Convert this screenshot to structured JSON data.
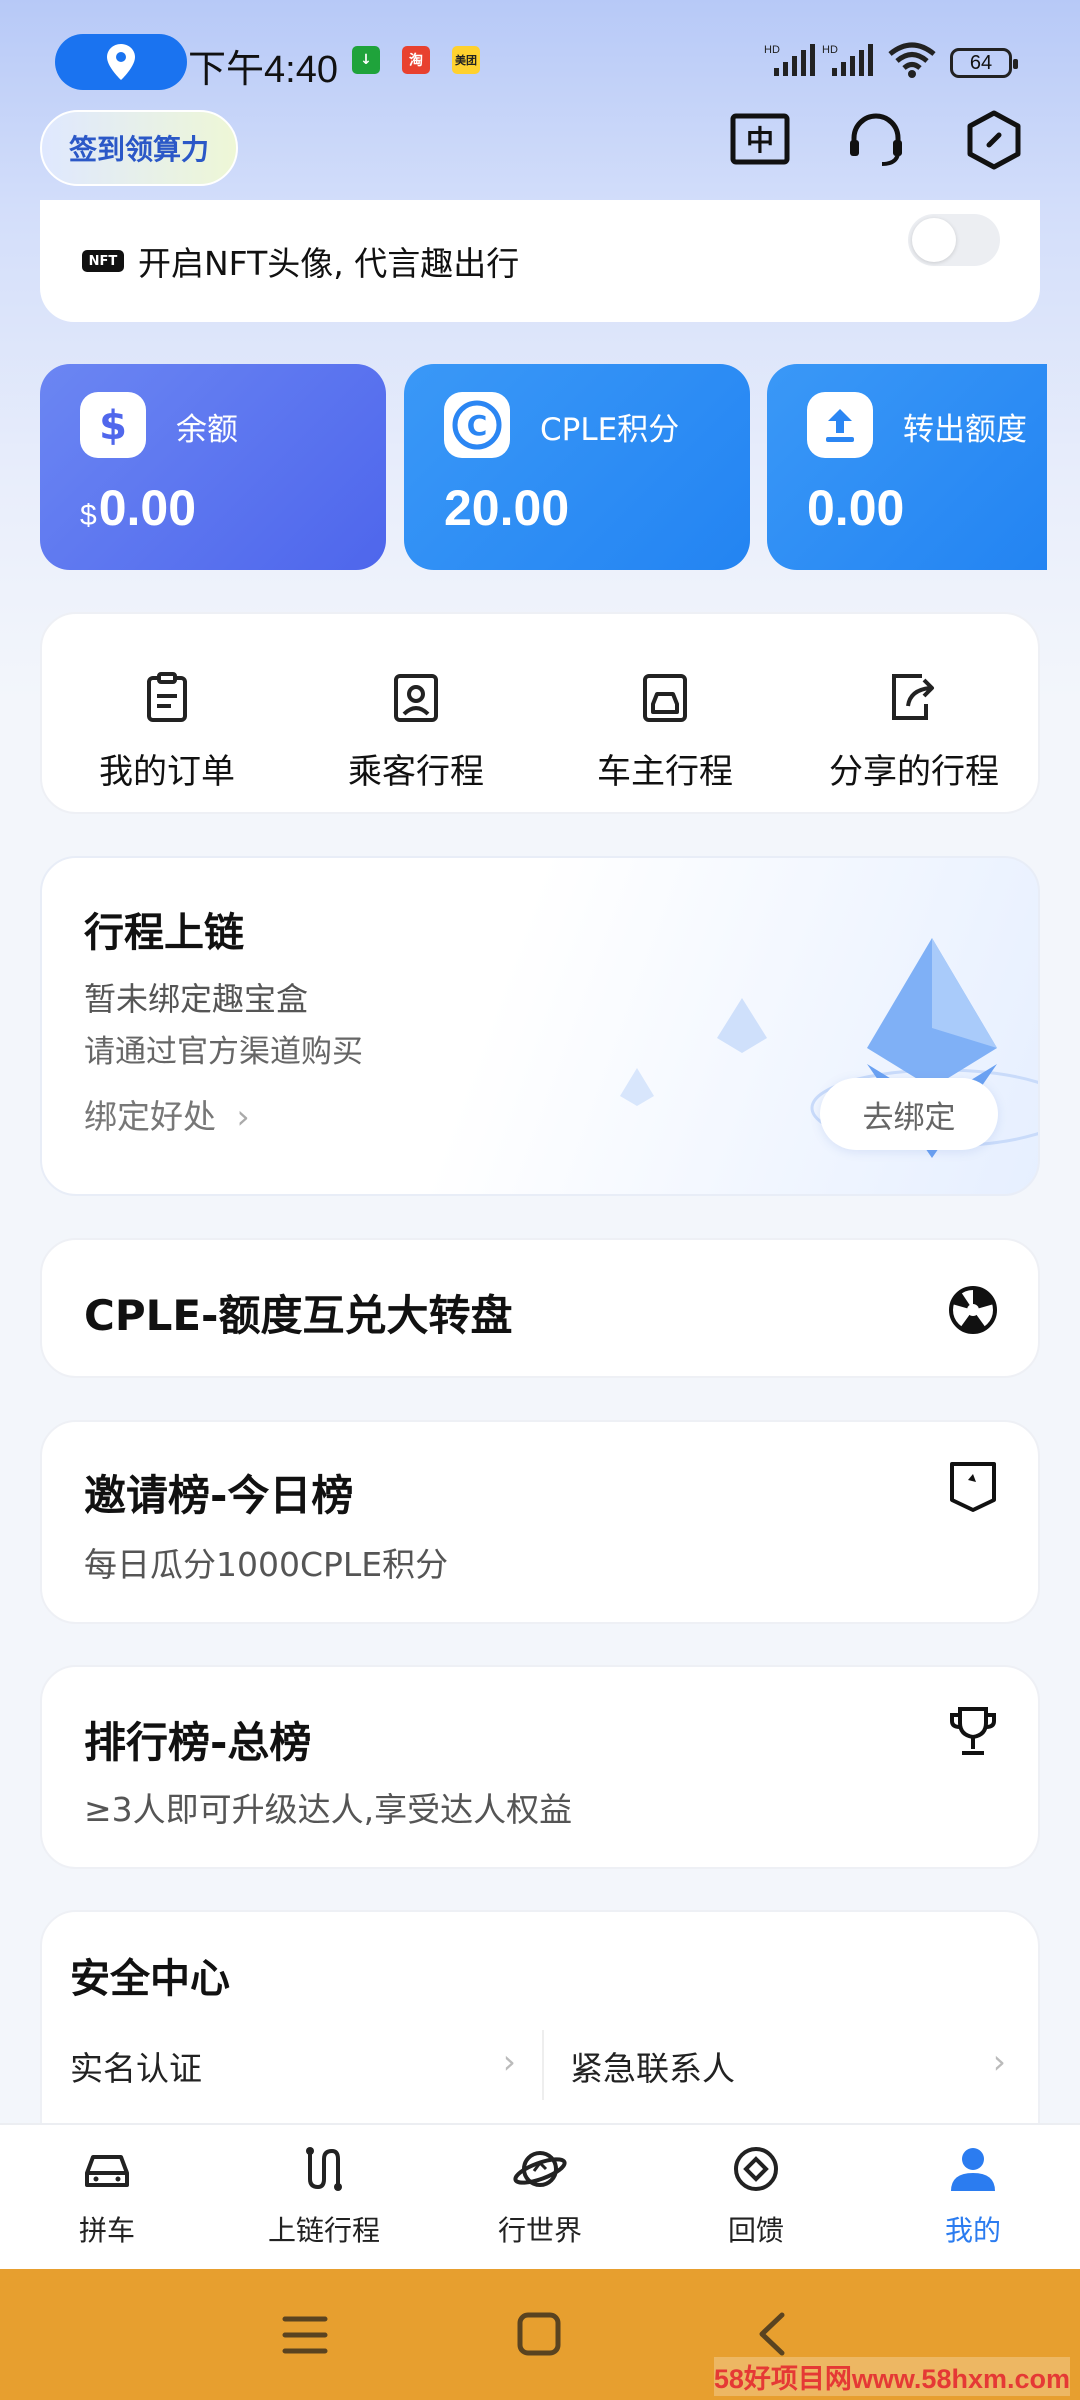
{
  "status_bar": {
    "time": "下午4:40",
    "battery": "64",
    "signal_label": "HD"
  },
  "header": {
    "signin_label": "签到领算力"
  },
  "nft": {
    "badge": "NFT",
    "text": "开启NFT头像, 代言趣出行",
    "toggle_on": false
  },
  "balances": [
    {
      "label": "余额",
      "currency": "$",
      "value": "0.00",
      "color": "#5271ee"
    },
    {
      "label": "CPLE积分",
      "value": "20.00",
      "color": "#2e8bf5"
    },
    {
      "label": "转出额度",
      "value": "0.00",
      "color": "#2e8bf5"
    }
  ],
  "shortcuts": [
    {
      "label": "我的订单",
      "icon": "clipboard-icon"
    },
    {
      "label": "乘客行程",
      "icon": "passenger-trip-icon"
    },
    {
      "label": "车主行程",
      "icon": "driver-trip-icon"
    },
    {
      "label": "分享的行程",
      "icon": "share-trip-icon"
    }
  ],
  "chain": {
    "title": "行程上链",
    "subtitle1": "暂未绑定趣宝盒",
    "subtitle2": "请通过官方渠道购买",
    "link": "绑定好处",
    "button": "去绑定"
  },
  "wheel": {
    "title": "CPLE-额度互兑大转盘"
  },
  "invite_board": {
    "title": "邀请榜-今日榜",
    "subtitle": "每日瓜分1000CPLE积分"
  },
  "rank_board": {
    "title": "排行榜-总榜",
    "subtitle": "≥3人即可升级达人,享受达人权益"
  },
  "safety": {
    "title": "安全中心",
    "items": [
      "实名认证",
      "紧急联系人"
    ]
  },
  "nav": {
    "items": [
      {
        "label": "拼车",
        "icon": "car-icon"
      },
      {
        "label": "上链行程",
        "icon": "route-icon"
      },
      {
        "label": "行世界",
        "icon": "planet-icon"
      },
      {
        "label": "回馈",
        "icon": "reward-icon"
      },
      {
        "label": "我的",
        "icon": "profile-icon"
      }
    ],
    "active_color": "#2b7cf0"
  },
  "watermark": "58好项目网www.58hxm.com"
}
